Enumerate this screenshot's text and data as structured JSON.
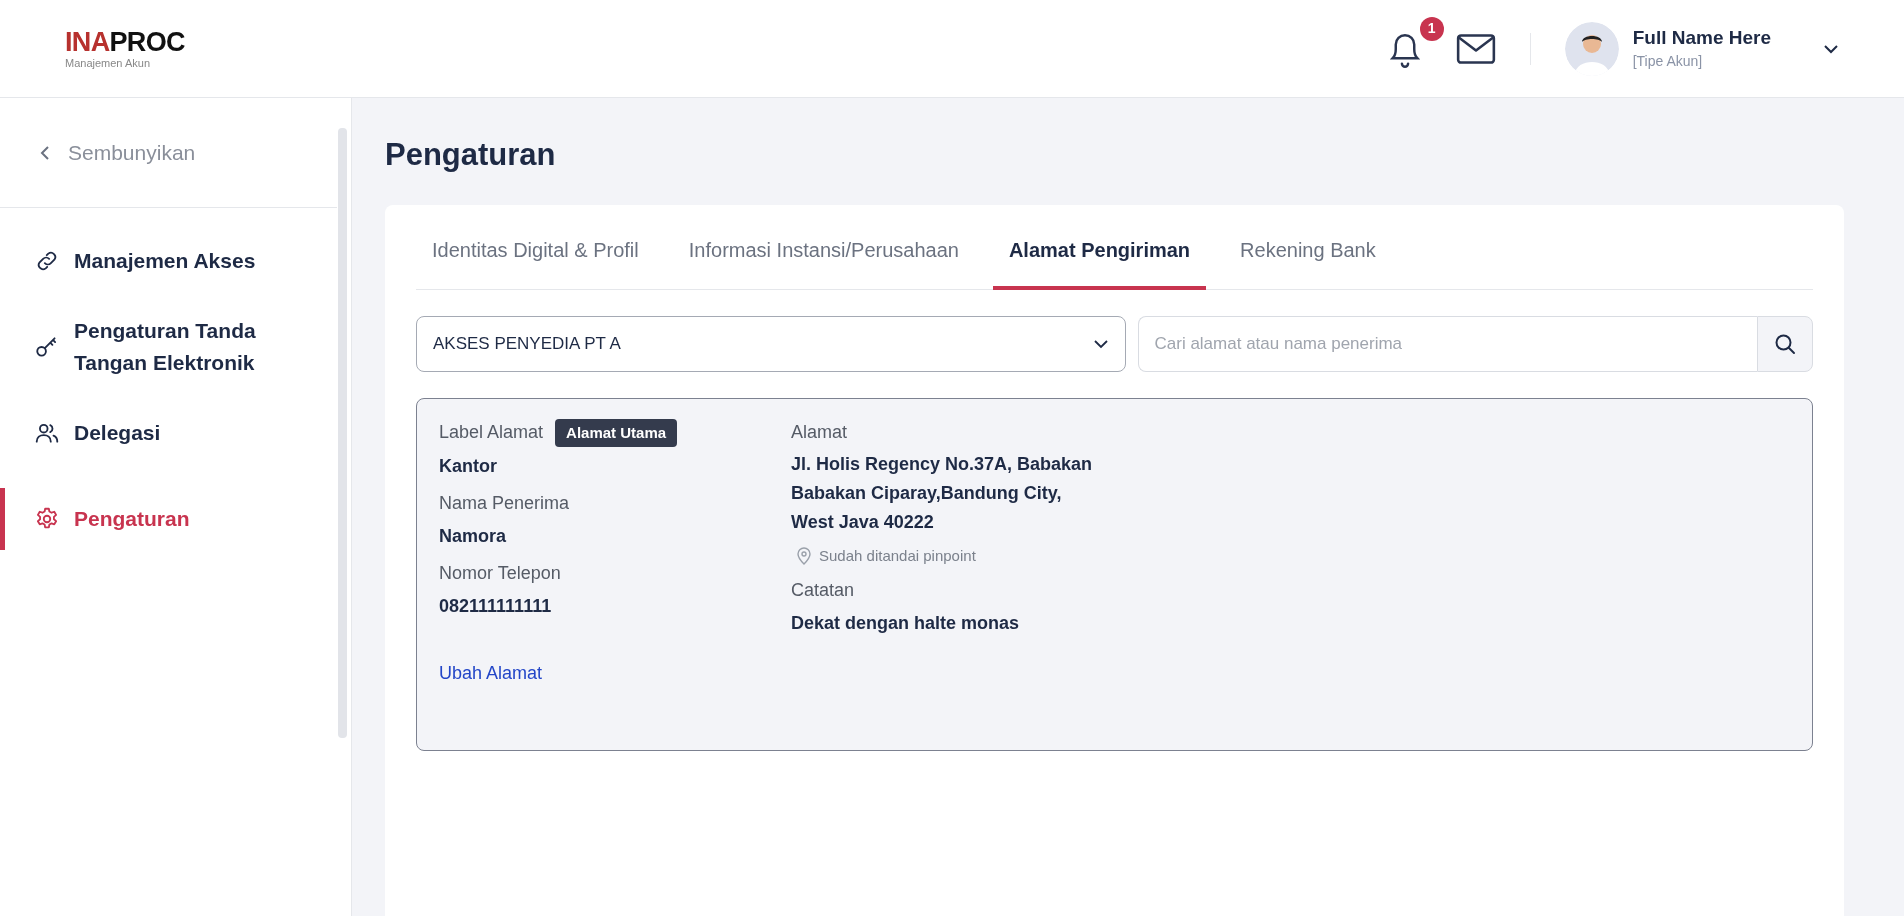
{
  "header": {
    "logo": {
      "part_1": "INA",
      "part_2": "PROC",
      "subtitle": "Manajemen Akun"
    },
    "notification_count": "1",
    "user": {
      "name": "Full Name Here",
      "role": "[Tipe Akun]"
    }
  },
  "sidebar": {
    "collapse": "Sembunyikan",
    "items": [
      {
        "label": "Manajemen Akses",
        "selected": false
      },
      {
        "label": "Pengaturan Tanda Tangan Elektronik",
        "selected": false
      },
      {
        "label": "Delegasi",
        "selected": false
      },
      {
        "label": "Pengaturan",
        "selected": true
      }
    ]
  },
  "page_title": "Pengaturan",
  "tabs": [
    {
      "label": "Identitas Digital & Profil",
      "selected": false
    },
    {
      "label": "Informasi Instansi/Perusahaan",
      "selected": false
    },
    {
      "label": "Alamat Pengiriman",
      "selected": true
    },
    {
      "label": "Rekening Bank",
      "selected": false
    }
  ],
  "filter": {
    "value": "AKSES PENYEDIA PT A"
  },
  "search": {
    "placeholder": "Cari alamat atau nama penerima"
  },
  "address": {
    "label_title": "Label Alamat",
    "badge": "Alamat Utama",
    "label": "Kantor",
    "recipient_title": "Nama Penerima",
    "recipient": "Namora",
    "phone_title": "Nomor Telepon",
    "phone": "082111111111",
    "edit_link": "Ubah Alamat",
    "address_title": "Alamat",
    "address_lines": [
      "Jl. Holis Regency No.37A, Babakan",
      "Babakan Ciparay,Bandung City,",
      "West Java 40222"
    ],
    "pinpoint": "Sudah ditandai pinpoint",
    "note_title": "Catatan",
    "note": "Dekat dengan halte monas"
  }
}
